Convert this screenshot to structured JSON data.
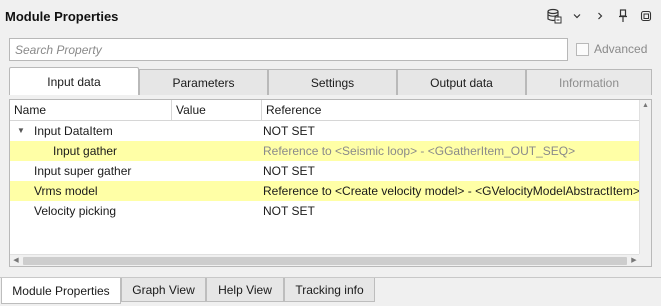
{
  "window": {
    "title": "Module Properties"
  },
  "toolbar_icons": [
    "database-icon",
    "chevron-down-icon",
    "chevron-right-icon",
    "pin-icon",
    "restore-window-icon"
  ],
  "search": {
    "placeholder": "Search Property",
    "value": ""
  },
  "advanced": {
    "label": "Advanced",
    "checked": false
  },
  "tabs": [
    {
      "label": "Input data",
      "active": true
    },
    {
      "label": "Parameters"
    },
    {
      "label": "Settings"
    },
    {
      "label": "Output data"
    },
    {
      "label": "Information",
      "disabled": true
    }
  ],
  "table": {
    "columns": [
      "Name",
      "Value",
      "Reference"
    ],
    "rows": [
      {
        "name": "Input DataItem",
        "value": "",
        "reference": "NOT SET",
        "expanded": true,
        "highlight": false
      },
      {
        "name": "Input gather",
        "value": "",
        "reference": "Reference to <Seismic loop> - <GGatherItem_OUT_SEQ>",
        "highlight": true,
        "muted": true
      },
      {
        "name": "Input super gather",
        "value": "",
        "reference": "NOT SET",
        "highlight": false
      },
      {
        "name": "Vrms model",
        "value": "",
        "reference": "Reference to <Create velocity model> - <GVelocityModelAbstractItem>",
        "highlight": true
      },
      {
        "name": "Velocity picking",
        "value": "",
        "reference": "NOT SET",
        "highlight": false
      }
    ]
  },
  "bottom_tabs": [
    {
      "label": "Module Properties",
      "active": true
    },
    {
      "label": "Graph View"
    },
    {
      "label": "Help View"
    },
    {
      "label": "Tracking info"
    }
  ],
  "colors": {
    "highlight": "#ffffa6",
    "muted_text": "#8a8a8a"
  }
}
